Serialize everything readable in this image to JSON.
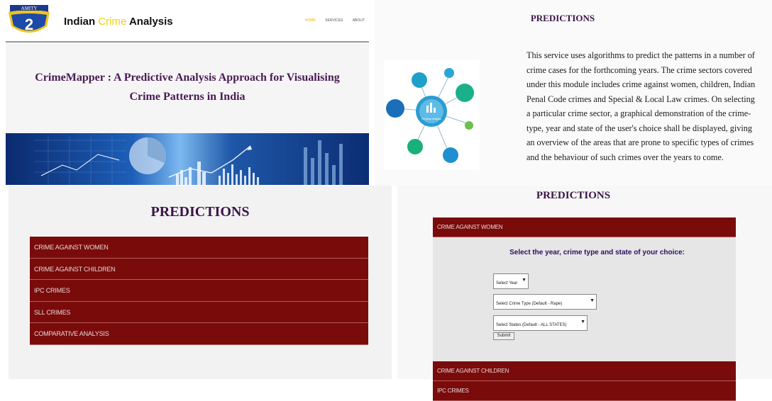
{
  "header": {
    "logo_text": "AMITY",
    "brand_part1": "Indian ",
    "brand_part2": "Crime",
    "brand_part3": " Analysis",
    "nav": [
      "HOME",
      "SERVICES",
      "ABOUT"
    ]
  },
  "home": {
    "title_line1": "CrimeMapper : A Predictive Analysis Approach for Visualising",
    "title_line2": "Crime Patterns in India"
  },
  "predictions_info": {
    "heading": "PREDICTIONS",
    "image_center_label": "Predictive Analytics",
    "description_lines": [
      "This service uses algorithms to predict the patterns in a number of",
      "crime cases for the forthcoming years. The crime sectors covered",
      "under this module includes crime against women, children, Indian",
      "Penal Code crimes and Special & Local Law crimes. On selecting",
      "a particular crime sector, a graphical demonstration of the crime-",
      "type, year and state of the user's choice shall be displayed, giving",
      "an overview of the areas that are prone to specific types of crimes",
      "and the behaviour of such crimes over the years to come."
    ]
  },
  "predictions_list": {
    "heading": "PREDICTIONS",
    "items": [
      "CRIME AGAINST WOMEN",
      "CRIME AGAINST CHILDREN",
      "IPC CRIMES",
      "SLL CRIMES",
      "COMPARATIVE ANALYSIS"
    ]
  },
  "predictions_form": {
    "heading": "PREDICTIONS",
    "active_sector": "CRIME AGAINST WOMEN",
    "prompt": "Select the year, crime type and state of your choice:",
    "year_select": "Select Year",
    "crime_type_select": "Select Crime Type (Default - Rape)",
    "state_select": "Select States (Default - ALL STATES)",
    "submit_label": "Submit",
    "other_sectors": [
      "CRIME AGAINST CHILDREN",
      "IPC CRIMES"
    ]
  },
  "colors": {
    "sector_bg": "#7a0b0b",
    "heading": "#3a1446",
    "brand_accent": "#f4d20b"
  }
}
